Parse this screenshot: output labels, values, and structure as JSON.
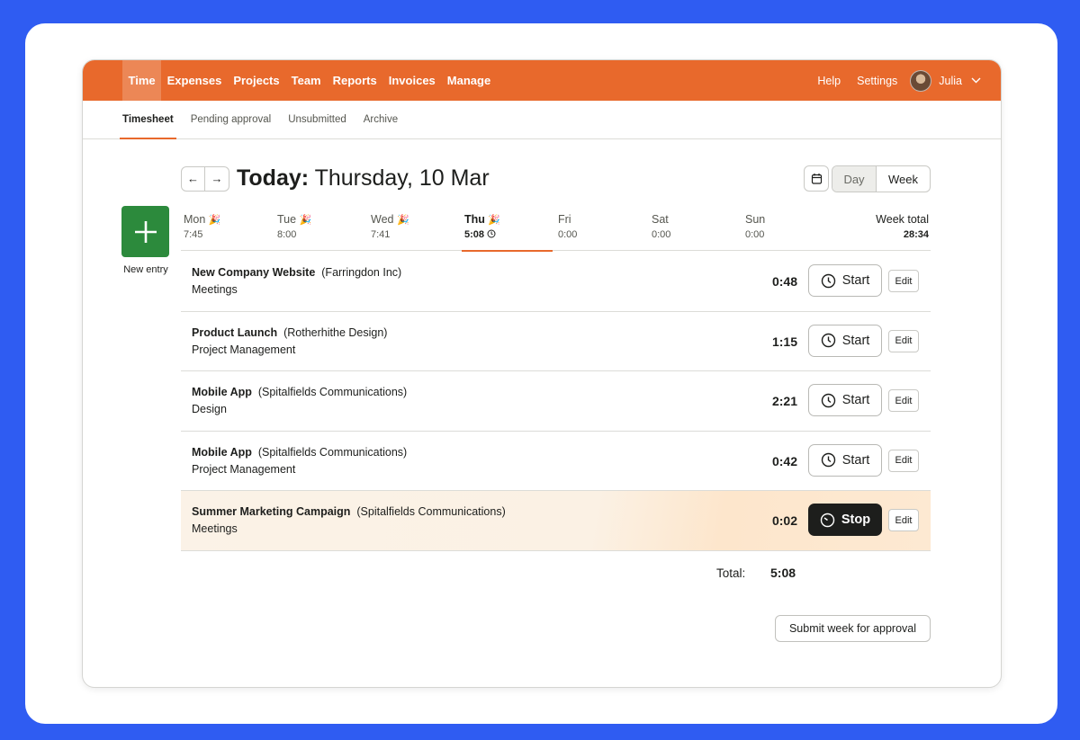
{
  "topnav": {
    "items": [
      "Time",
      "Expenses",
      "Projects",
      "Team",
      "Reports",
      "Invoices",
      "Manage"
    ],
    "help": "Help",
    "settings": "Settings",
    "user": "Julia",
    "accent": "#e8692c"
  },
  "subnav": {
    "items": [
      "Timesheet",
      "Pending approval",
      "Unsubmitted",
      "Archive"
    ]
  },
  "header": {
    "today_label": "Today:",
    "date": "Thursday, 10 Mar",
    "prev_icon": "←",
    "next_icon": "→",
    "view_day": "Day",
    "view_week": "Week"
  },
  "new_entry": {
    "label": "New entry",
    "color": "#2c8a3c"
  },
  "days": [
    {
      "name": "Mon",
      "total": "7:45"
    },
    {
      "name": "Tue",
      "total": "8:00"
    },
    {
      "name": "Wed",
      "total": "7:41"
    },
    {
      "name": "Thu",
      "total": "5:08"
    },
    {
      "name": "Fri",
      "total": "0:00"
    },
    {
      "name": "Sat",
      "total": "0:00"
    },
    {
      "name": "Sun",
      "total": "0:00"
    }
  ],
  "week_total": {
    "label": "Week total",
    "value": "28:34"
  },
  "entries": [
    {
      "project": "New Company Website",
      "client": "(Farringdon Inc)",
      "task": "Meetings",
      "duration": "0:48",
      "action": "Start",
      "edit": "Edit"
    },
    {
      "project": "Product Launch",
      "client": "(Rotherhithe Design)",
      "task": "Project Management",
      "duration": "1:15",
      "action": "Start",
      "edit": "Edit"
    },
    {
      "project": "Mobile App",
      "client": "(Spitalfields Communications)",
      "task": "Design",
      "duration": "2:21",
      "action": "Start",
      "edit": "Edit"
    },
    {
      "project": "Mobile App",
      "client": "(Spitalfields Communications)",
      "task": "Project Management",
      "duration": "0:42",
      "action": "Start",
      "edit": "Edit"
    },
    {
      "project": "Summer Marketing Campaign",
      "client": "(Spitalfields Communications)",
      "task": "Meetings",
      "duration": "0:02",
      "action": "Stop",
      "edit": "Edit"
    }
  ],
  "total": {
    "label": "Total:",
    "value": "5:08"
  },
  "submit_label": "Submit week for approval"
}
